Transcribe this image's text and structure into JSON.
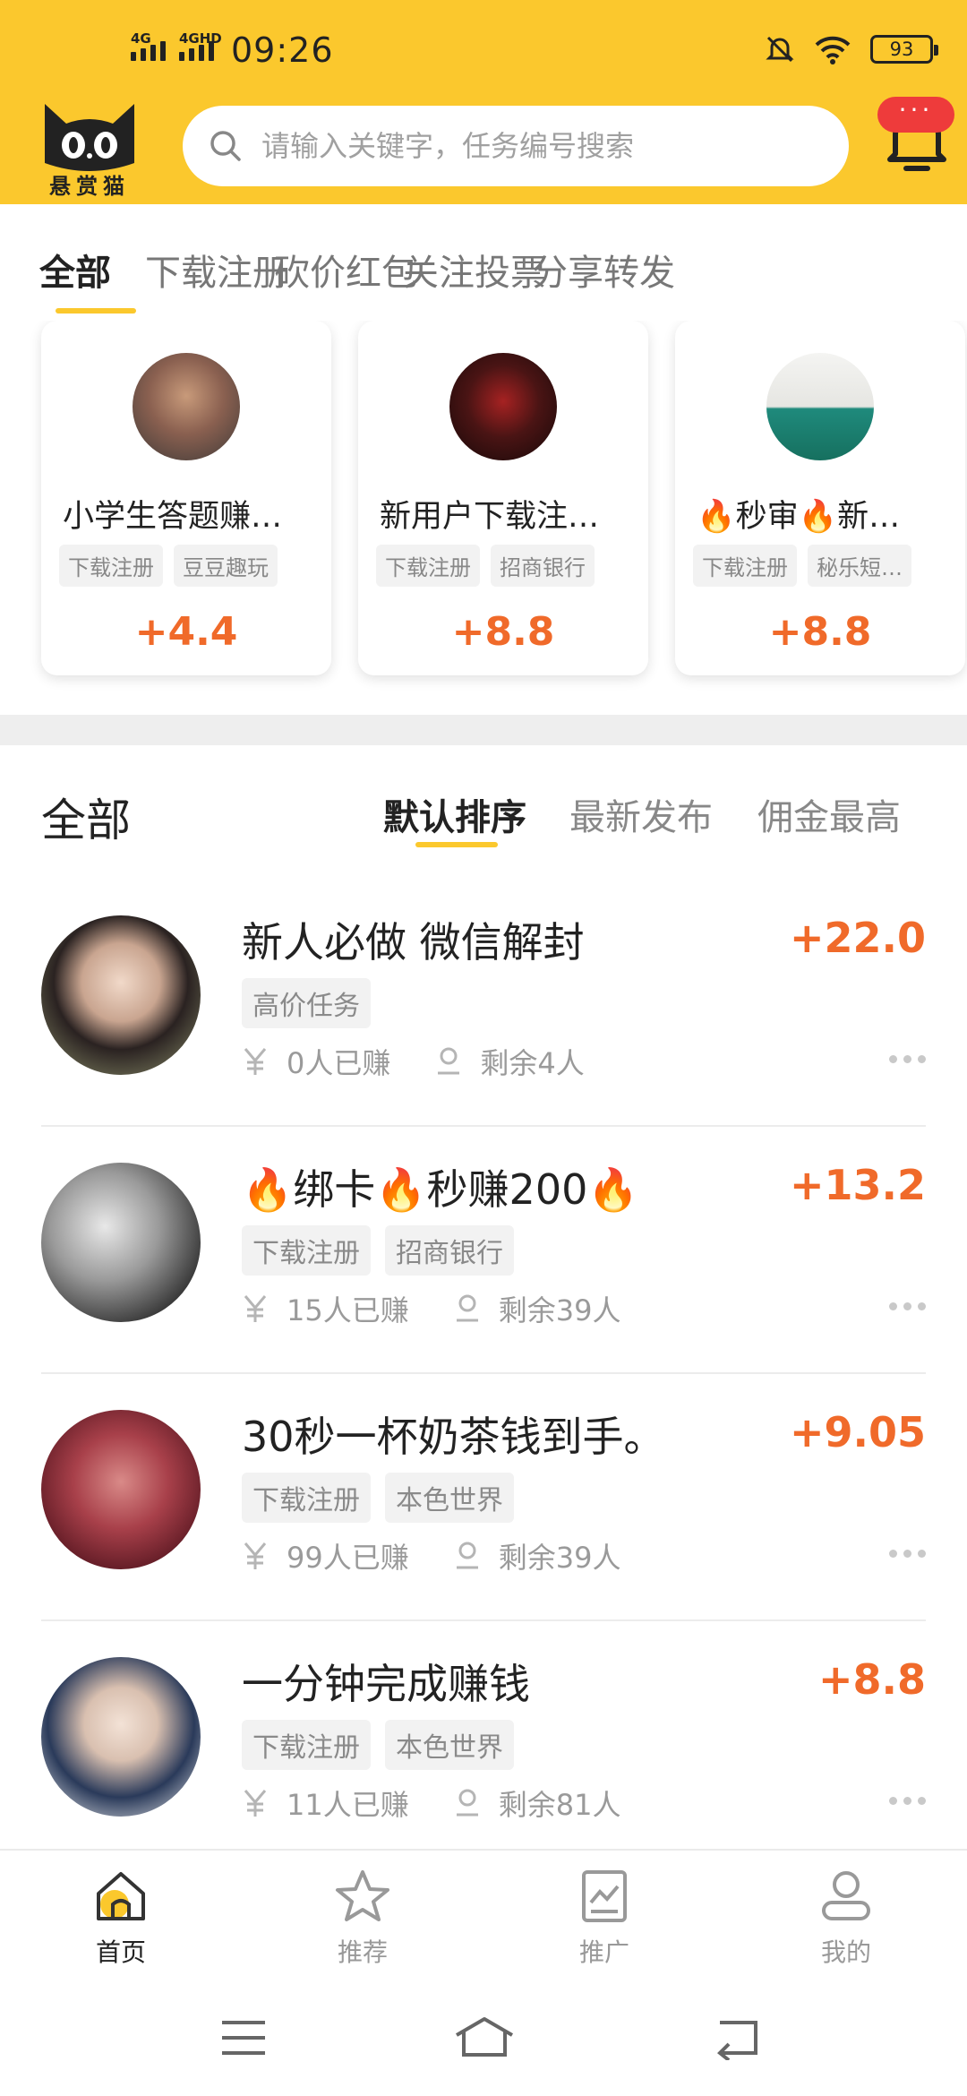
{
  "status_bar": {
    "net1": "4G",
    "net2": "4GHD",
    "time": "09:26",
    "battery": "93"
  },
  "header": {
    "logo_text": "悬赏猫",
    "logo_face": "0.0",
    "search_placeholder": "请输入关键字，任务编号搜索",
    "bell_badge": "···"
  },
  "category_tabs": [
    {
      "label": "全部",
      "active": true
    },
    {
      "label": "下载注册",
      "active": false
    },
    {
      "label": "砍价红包",
      "active": false
    },
    {
      "label": "关注投票",
      "active": false
    },
    {
      "label": "分享转发",
      "active": false
    }
  ],
  "featured": [
    {
      "title": "小学生答题赚…",
      "tags": [
        "下载注册",
        "豆豆趣玩"
      ],
      "reward": "+4.4"
    },
    {
      "title": "新用户下载注…",
      "tags": [
        "下载注册",
        "招商银行"
      ],
      "reward": "+8.8"
    },
    {
      "title": "🔥秒审🔥新…",
      "tags": [
        "下载注册",
        "秘乐短…"
      ],
      "reward": "+8.8"
    }
  ],
  "sort_bar": {
    "title": "全部",
    "options": [
      {
        "label": "默认排序",
        "active": true
      },
      {
        "label": "最新发布",
        "active": false
      },
      {
        "label": "佣金最高",
        "active": false
      }
    ]
  },
  "tasks": [
    {
      "title": "新人必做  微信解封",
      "reward": "+22.0",
      "tags": [
        "高价任务"
      ],
      "earned": "0人已赚",
      "remaining": "剩余4人"
    },
    {
      "title": "🔥绑卡🔥秒赚200🔥",
      "reward": "+13.2",
      "tags": [
        "下载注册",
        "招商银行"
      ],
      "earned": "15人已赚",
      "remaining": "剩余39人"
    },
    {
      "title": "30秒一杯奶茶钱到手。",
      "reward": "+9.05",
      "tags": [
        "下载注册",
        "本色世界"
      ],
      "earned": "99人已赚",
      "remaining": "剩余39人"
    },
    {
      "title": "一分钟完成赚钱",
      "reward": "+8.8",
      "tags": [
        "下载注册",
        "本色世界"
      ],
      "earned": "11人已赚",
      "remaining": "剩余81人"
    }
  ],
  "bottom_nav": [
    {
      "label": "首页",
      "icon": "home-icon",
      "active": true
    },
    {
      "label": "推荐",
      "icon": "star-icon",
      "active": false
    },
    {
      "label": "推广",
      "icon": "chart-icon",
      "active": false
    },
    {
      "label": "我的",
      "icon": "user-icon",
      "active": false
    }
  ],
  "colors": {
    "brand_yellow": "#fbc82d",
    "reward_orange": "#f06a2a",
    "tag_bg": "#f2f2f2",
    "badge_red": "#ee3b3b"
  }
}
